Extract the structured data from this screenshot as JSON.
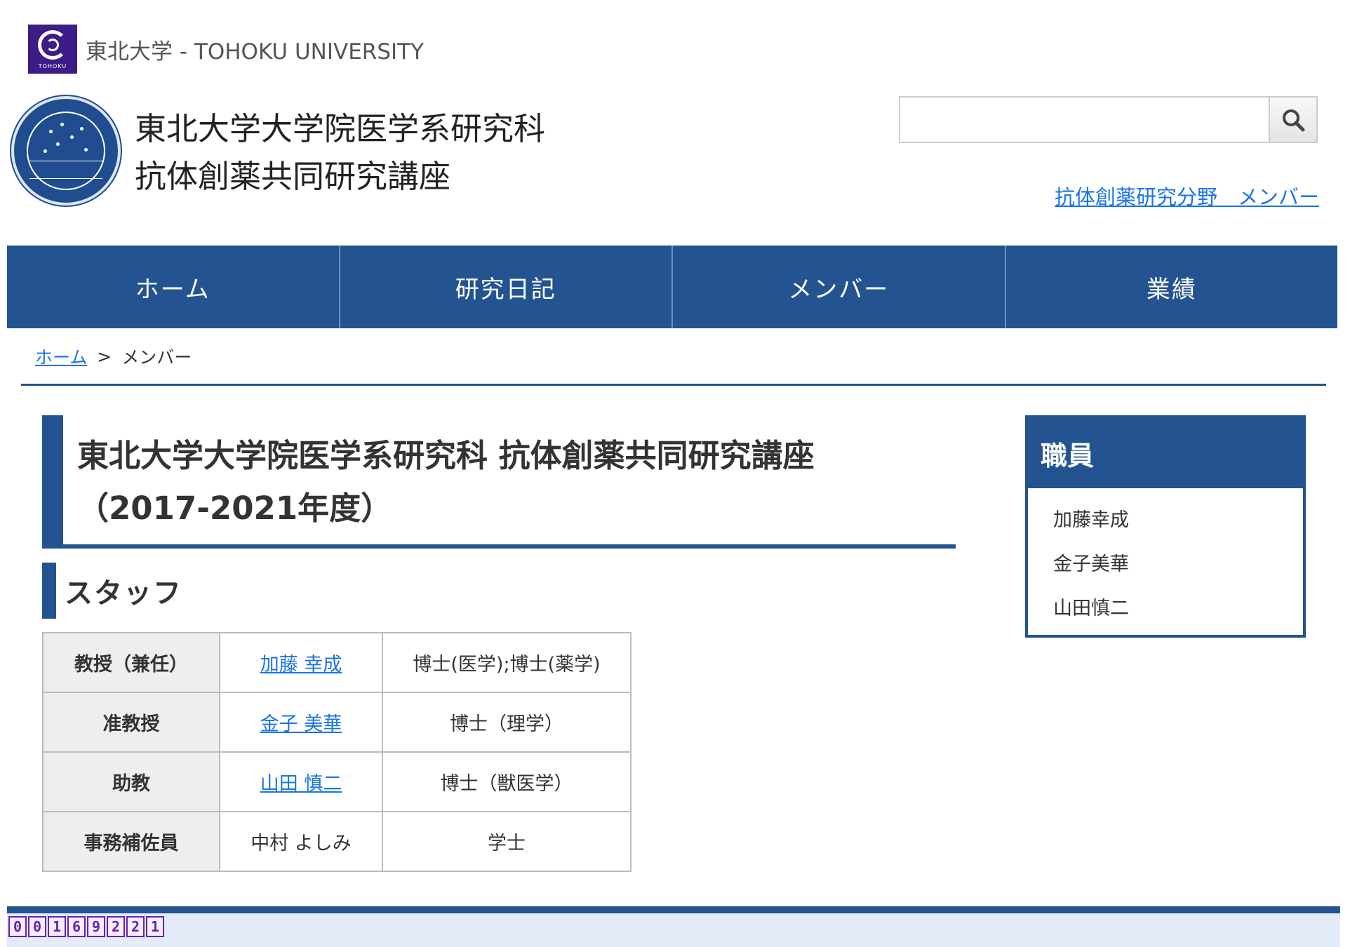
{
  "university_bar": {
    "logo_text": "TOHOKU",
    "name": "東北大学 - TOHOKU UNIVERSITY"
  },
  "header": {
    "title_line1": "東北大学大学院医学系研究科",
    "title_line2": "抗体創薬共同研究講座",
    "search": {
      "value": "",
      "placeholder": ""
    },
    "member_link": "抗体創薬研究分野　メンバー"
  },
  "nav": {
    "items": [
      "ホーム",
      "研究日記",
      "メンバー",
      "業績"
    ]
  },
  "breadcrumb": {
    "home": "ホーム",
    "separator": ">",
    "current": "メンバー"
  },
  "main": {
    "heading_line1": "東北大学大学院医学系研究科 抗体創薬共同研究講座",
    "heading_line2": "（2017-2021年度）",
    "section_title": "スタッフ",
    "staff": [
      {
        "role": "教授（兼任）",
        "name": "加藤 幸成",
        "degree": "博士(医学);博士(薬学)"
      },
      {
        "role": "准教授",
        "name": "金子 美華",
        "degree": "博士（理学）"
      },
      {
        "role": "助教",
        "name": "山田 慎二",
        "degree": "博士（獣医学）"
      },
      {
        "role": "事務補佐員",
        "name": "中村 よしみ",
        "degree": "学士"
      }
    ]
  },
  "sidebar": {
    "title": "職員",
    "items": [
      "加藤幸成",
      "金子美華",
      "山田慎二"
    ]
  },
  "footer": {
    "counter_digits": [
      "0",
      "0",
      "1",
      "6",
      "9",
      "2",
      "2",
      "1"
    ]
  },
  "colors": {
    "brand_blue": "#235390",
    "link_blue": "#1a73e8",
    "university_purple": "#3d1c87",
    "footer_bg": "#e2ebf7"
  }
}
